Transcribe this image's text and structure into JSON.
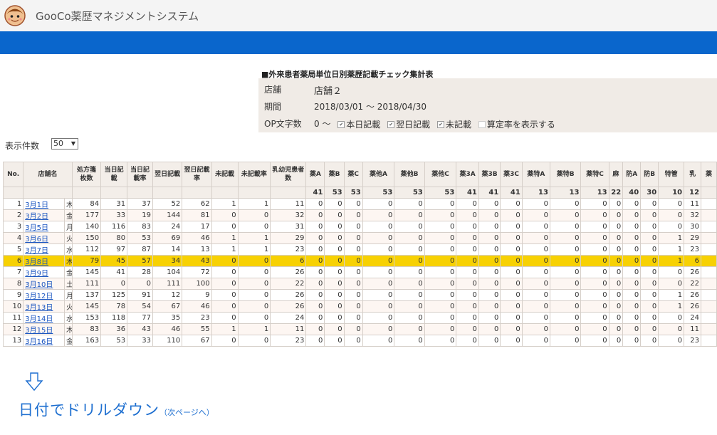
{
  "header": {
    "app_title": "GooCo薬歴マネジメントシステム"
  },
  "summary": {
    "title": "■外来患者薬局単位日別薬歴記載チェック集計表",
    "store_label": "店舗",
    "store_value": "店舗２",
    "period_label": "期間",
    "period_value": "2018/03/01 ～ 2018/04/30",
    "op_label": "OP文字数",
    "op_value": "0 ～",
    "options": [
      {
        "label": "本日記載",
        "checked": true
      },
      {
        "label": "翌日記載",
        "checked": true
      },
      {
        "label": "未記載",
        "checked": true
      },
      {
        "label": "算定率を表示する",
        "checked": false
      }
    ]
  },
  "display_count": {
    "label": "表示件数",
    "value": "50"
  },
  "table": {
    "headers": [
      "No.",
      "店舗名",
      "処方箋枚数",
      "当日記載",
      "当日記載率",
      "翌日記載",
      "翌日記載率",
      "未記載",
      "未記載率",
      "乳幼児患者数",
      "薬A",
      "薬B",
      "薬C",
      "薬他A",
      "薬他B",
      "薬他C",
      "薬3A",
      "薬3B",
      "薬3C",
      "薬特A",
      "薬特B",
      "薬特C",
      "麻",
      "防A",
      "防B",
      "特管",
      "乳",
      "薬"
    ],
    "subheaders": [
      "",
      "",
      "",
      "",
      "",
      "",
      "",
      "",
      "",
      "",
      "41",
      "53",
      "53",
      "53",
      "53",
      "53",
      "41",
      "41",
      "41",
      "13",
      "13",
      "13",
      "22",
      "40",
      "30",
      "10",
      "12",
      ""
    ],
    "rows": [
      {
        "no": "1",
        "date": "3月1日",
        "wd": "木",
        "v": [
          "84",
          "31",
          "37",
          "52",
          "62",
          "1",
          "1",
          "11",
          "0",
          "0",
          "0",
          "0",
          "0",
          "0",
          "0",
          "0",
          "0",
          "0",
          "0",
          "0",
          "0",
          "0",
          "0",
          "0",
          "11"
        ]
      },
      {
        "no": "2",
        "date": "3月2日",
        "wd": "金",
        "v": [
          "177",
          "33",
          "19",
          "144",
          "81",
          "0",
          "0",
          "32",
          "0",
          "0",
          "0",
          "0",
          "0",
          "0",
          "0",
          "0",
          "0",
          "0",
          "0",
          "0",
          "0",
          "0",
          "0",
          "0",
          "32"
        ]
      },
      {
        "no": "3",
        "date": "3月5日",
        "wd": "月",
        "v": [
          "140",
          "116",
          "83",
          "24",
          "17",
          "0",
          "0",
          "31",
          "0",
          "0",
          "0",
          "0",
          "0",
          "0",
          "0",
          "0",
          "0",
          "0",
          "0",
          "0",
          "0",
          "0",
          "0",
          "0",
          "30"
        ]
      },
      {
        "no": "4",
        "date": "3月6日",
        "wd": "火",
        "v": [
          "150",
          "80",
          "53",
          "69",
          "46",
          "1",
          "1",
          "29",
          "0",
          "0",
          "0",
          "0",
          "0",
          "0",
          "0",
          "0",
          "0",
          "0",
          "0",
          "0",
          "0",
          "0",
          "0",
          "1",
          "29"
        ]
      },
      {
        "no": "5",
        "date": "3月7日",
        "wd": "水",
        "v": [
          "112",
          "97",
          "87",
          "14",
          "13",
          "1",
          "1",
          "23",
          "0",
          "0",
          "0",
          "0",
          "0",
          "0",
          "0",
          "0",
          "0",
          "0",
          "0",
          "0",
          "0",
          "0",
          "0",
          "1",
          "23"
        ]
      },
      {
        "no": "6",
        "date": "3月8日",
        "wd": "木",
        "v": [
          "79",
          "45",
          "57",
          "34",
          "43",
          "0",
          "0",
          "6",
          "0",
          "0",
          "0",
          "0",
          "0",
          "0",
          "0",
          "0",
          "0",
          "0",
          "0",
          "0",
          "0",
          "0",
          "0",
          "1",
          "6"
        ],
        "hl": true
      },
      {
        "no": "7",
        "date": "3月9日",
        "wd": "金",
        "v": [
          "145",
          "41",
          "28",
          "104",
          "72",
          "0",
          "0",
          "26",
          "0",
          "0",
          "0",
          "0",
          "0",
          "0",
          "0",
          "0",
          "0",
          "0",
          "0",
          "0",
          "0",
          "0",
          "0",
          "0",
          "26"
        ]
      },
      {
        "no": "8",
        "date": "3月10日",
        "wd": "土",
        "v": [
          "111",
          "0",
          "0",
          "111",
          "100",
          "0",
          "0",
          "22",
          "0",
          "0",
          "0",
          "0",
          "0",
          "0",
          "0",
          "0",
          "0",
          "0",
          "0",
          "0",
          "0",
          "0",
          "0",
          "0",
          "22"
        ]
      },
      {
        "no": "9",
        "date": "3月12日",
        "wd": "月",
        "v": [
          "137",
          "125",
          "91",
          "12",
          "9",
          "0",
          "0",
          "26",
          "0",
          "0",
          "0",
          "0",
          "0",
          "0",
          "0",
          "0",
          "0",
          "0",
          "0",
          "0",
          "0",
          "0",
          "0",
          "1",
          "26"
        ]
      },
      {
        "no": "10",
        "date": "3月13日",
        "wd": "火",
        "v": [
          "145",
          "78",
          "54",
          "67",
          "46",
          "0",
          "0",
          "26",
          "0",
          "0",
          "0",
          "0",
          "0",
          "0",
          "0",
          "0",
          "0",
          "0",
          "0",
          "0",
          "0",
          "0",
          "0",
          "1",
          "26"
        ]
      },
      {
        "no": "11",
        "date": "3月14日",
        "wd": "水",
        "v": [
          "153",
          "118",
          "77",
          "35",
          "23",
          "0",
          "0",
          "24",
          "0",
          "0",
          "0",
          "0",
          "0",
          "0",
          "0",
          "0",
          "0",
          "0",
          "0",
          "0",
          "0",
          "0",
          "0",
          "0",
          "24"
        ]
      },
      {
        "no": "12",
        "date": "3月15日",
        "wd": "木",
        "v": [
          "83",
          "36",
          "43",
          "46",
          "55",
          "1",
          "1",
          "11",
          "0",
          "0",
          "0",
          "0",
          "0",
          "0",
          "0",
          "0",
          "0",
          "0",
          "0",
          "0",
          "0",
          "0",
          "0",
          "0",
          "11"
        ]
      },
      {
        "no": "13",
        "date": "3月16日",
        "wd": "金",
        "v": [
          "163",
          "53",
          "33",
          "110",
          "67",
          "0",
          "0",
          "23",
          "0",
          "0",
          "0",
          "0",
          "0",
          "0",
          "0",
          "0",
          "0",
          "0",
          "0",
          "0",
          "0",
          "0",
          "0",
          "0",
          "23"
        ]
      }
    ]
  },
  "annotation": {
    "main": "日付でドリルダウン",
    "sub": "（次ページへ）"
  },
  "colors": {
    "blue_bar": "#0a66cc",
    "highlight_row": "#f7d103",
    "link": "#1a55c0",
    "annotation": "#1e6fd0"
  },
  "icons": {
    "logo": "pharmacist-avatar-icon",
    "arrow": "down-arrow-icon"
  }
}
